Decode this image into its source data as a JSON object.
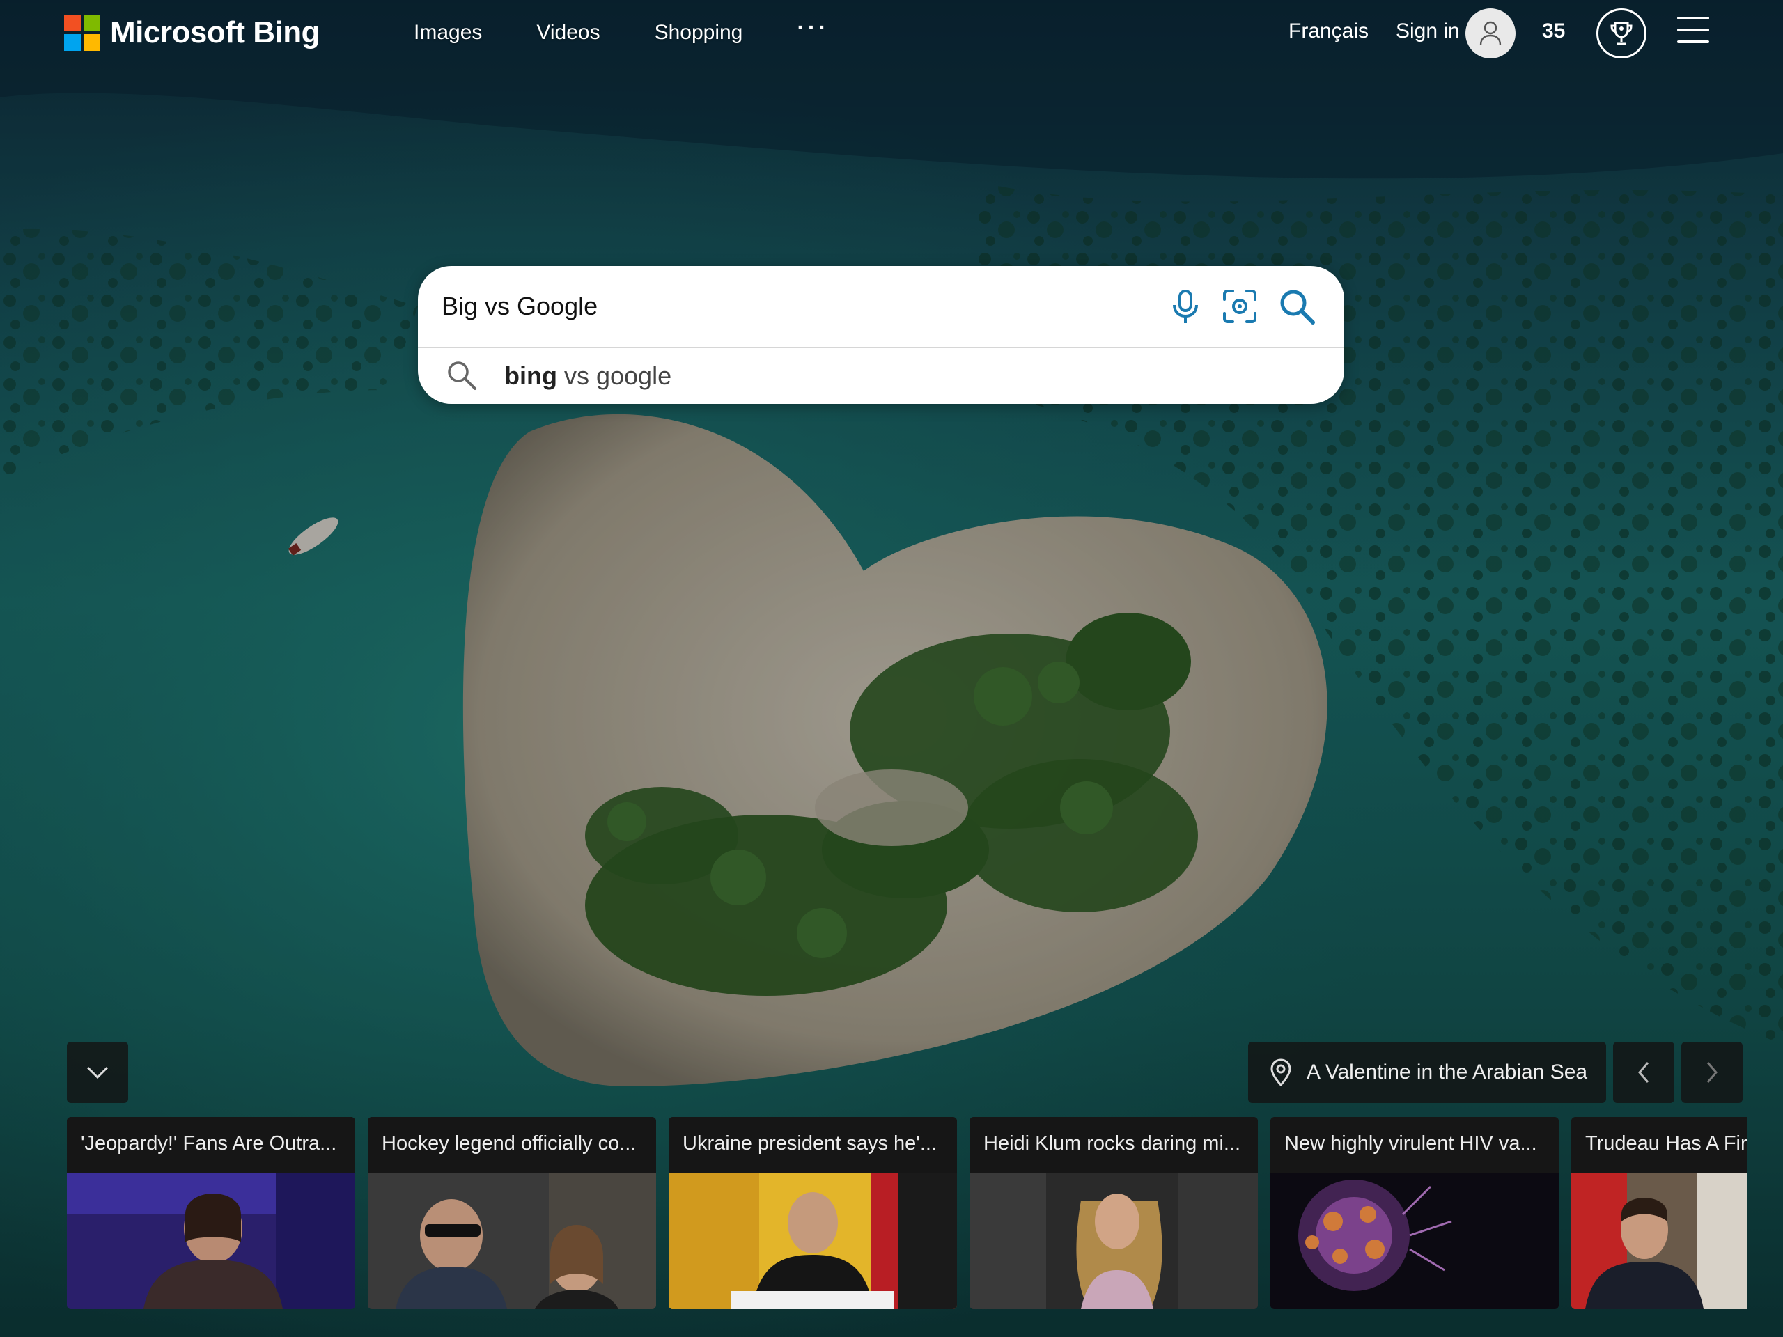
{
  "header": {
    "brand": "Microsoft Bing",
    "logo_colors": [
      "#f25022",
      "#7fba00",
      "#00a4ef",
      "#ffb900"
    ],
    "nav": [
      "Images",
      "Videos",
      "Shopping"
    ],
    "more_label": "···",
    "language": "Français",
    "sign_in": "Sign in",
    "points": "35"
  },
  "search": {
    "query": "Big vs Google",
    "suggestion_bold": "bing",
    "suggestion_rest": " vs google",
    "accent_color": "#1a7ab0"
  },
  "background": {
    "caption": "A Valentine in the Arabian Sea"
  },
  "news": [
    {
      "title": "'Jeopardy!' Fans Are Outra..."
    },
    {
      "title": "Hockey legend officially co..."
    },
    {
      "title": "Ukraine president says he'..."
    },
    {
      "title": "Heidi Klum rocks daring mi..."
    },
    {
      "title": "New highly virulent HIV va..."
    },
    {
      "title": "Trudeau Has A Fir"
    }
  ]
}
